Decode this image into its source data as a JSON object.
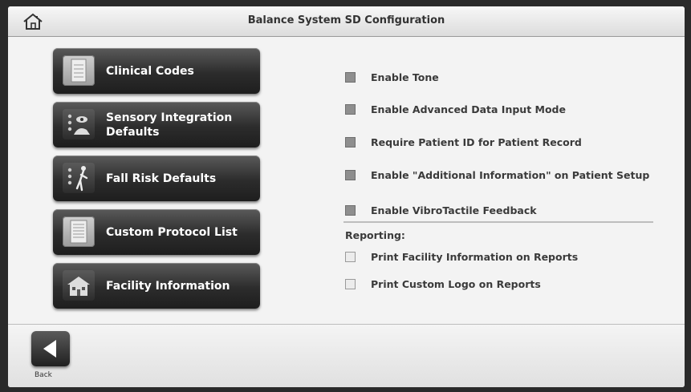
{
  "header": {
    "title": "Balance System SD Configuration",
    "home_icon": "home-icon"
  },
  "nav": [
    {
      "label": "Clinical Codes",
      "icon": "clipboard-icon"
    },
    {
      "label": "Sensory Integration Defaults",
      "icon": "sensory-icon"
    },
    {
      "label": "Fall Risk Defaults",
      "icon": "fall-figure-icon"
    },
    {
      "label": "Custom Protocol List",
      "icon": "list-icon"
    },
    {
      "label": "Facility Information",
      "icon": "building-icon"
    }
  ],
  "options": [
    {
      "label": "Enable Tone",
      "checked": false
    },
    {
      "label": "Enable Advanced Data Input Mode",
      "checked": false
    },
    {
      "label": "Require Patient ID for Patient Record",
      "checked": false
    },
    {
      "label": "Enable \"Additional Information\" on Patient Setup",
      "checked": false
    },
    {
      "label": "Enable VibroTactile Feedback",
      "checked": false
    }
  ],
  "reporting": {
    "heading": "Reporting:",
    "options": [
      {
        "label": "Print Facility Information on Reports",
        "checked": false
      },
      {
        "label": "Print Custom Logo on Reports",
        "checked": false
      }
    ]
  },
  "footer": {
    "back_label": "Back",
    "back_icon": "back-arrow-icon"
  }
}
